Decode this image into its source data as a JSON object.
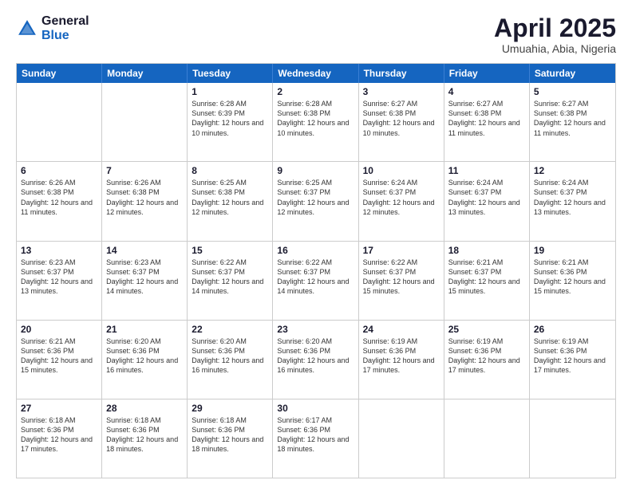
{
  "logo": {
    "general": "General",
    "blue": "Blue"
  },
  "title": {
    "month": "April 2025",
    "location": "Umuahia, Abia, Nigeria"
  },
  "weekdays": [
    "Sunday",
    "Monday",
    "Tuesday",
    "Wednesday",
    "Thursday",
    "Friday",
    "Saturday"
  ],
  "rows": [
    [
      {
        "day": "",
        "info": ""
      },
      {
        "day": "",
        "info": ""
      },
      {
        "day": "1",
        "info": "Sunrise: 6:28 AM\nSunset: 6:39 PM\nDaylight: 12 hours and 10 minutes."
      },
      {
        "day": "2",
        "info": "Sunrise: 6:28 AM\nSunset: 6:38 PM\nDaylight: 12 hours and 10 minutes."
      },
      {
        "day": "3",
        "info": "Sunrise: 6:27 AM\nSunset: 6:38 PM\nDaylight: 12 hours and 10 minutes."
      },
      {
        "day": "4",
        "info": "Sunrise: 6:27 AM\nSunset: 6:38 PM\nDaylight: 12 hours and 11 minutes."
      },
      {
        "day": "5",
        "info": "Sunrise: 6:27 AM\nSunset: 6:38 PM\nDaylight: 12 hours and 11 minutes."
      }
    ],
    [
      {
        "day": "6",
        "info": "Sunrise: 6:26 AM\nSunset: 6:38 PM\nDaylight: 12 hours and 11 minutes."
      },
      {
        "day": "7",
        "info": "Sunrise: 6:26 AM\nSunset: 6:38 PM\nDaylight: 12 hours and 12 minutes."
      },
      {
        "day": "8",
        "info": "Sunrise: 6:25 AM\nSunset: 6:38 PM\nDaylight: 12 hours and 12 minutes."
      },
      {
        "day": "9",
        "info": "Sunrise: 6:25 AM\nSunset: 6:37 PM\nDaylight: 12 hours and 12 minutes."
      },
      {
        "day": "10",
        "info": "Sunrise: 6:24 AM\nSunset: 6:37 PM\nDaylight: 12 hours and 12 minutes."
      },
      {
        "day": "11",
        "info": "Sunrise: 6:24 AM\nSunset: 6:37 PM\nDaylight: 12 hours and 13 minutes."
      },
      {
        "day": "12",
        "info": "Sunrise: 6:24 AM\nSunset: 6:37 PM\nDaylight: 12 hours and 13 minutes."
      }
    ],
    [
      {
        "day": "13",
        "info": "Sunrise: 6:23 AM\nSunset: 6:37 PM\nDaylight: 12 hours and 13 minutes."
      },
      {
        "day": "14",
        "info": "Sunrise: 6:23 AM\nSunset: 6:37 PM\nDaylight: 12 hours and 14 minutes."
      },
      {
        "day": "15",
        "info": "Sunrise: 6:22 AM\nSunset: 6:37 PM\nDaylight: 12 hours and 14 minutes."
      },
      {
        "day": "16",
        "info": "Sunrise: 6:22 AM\nSunset: 6:37 PM\nDaylight: 12 hours and 14 minutes."
      },
      {
        "day": "17",
        "info": "Sunrise: 6:22 AM\nSunset: 6:37 PM\nDaylight: 12 hours and 15 minutes."
      },
      {
        "day": "18",
        "info": "Sunrise: 6:21 AM\nSunset: 6:37 PM\nDaylight: 12 hours and 15 minutes."
      },
      {
        "day": "19",
        "info": "Sunrise: 6:21 AM\nSunset: 6:36 PM\nDaylight: 12 hours and 15 minutes."
      }
    ],
    [
      {
        "day": "20",
        "info": "Sunrise: 6:21 AM\nSunset: 6:36 PM\nDaylight: 12 hours and 15 minutes."
      },
      {
        "day": "21",
        "info": "Sunrise: 6:20 AM\nSunset: 6:36 PM\nDaylight: 12 hours and 16 minutes."
      },
      {
        "day": "22",
        "info": "Sunrise: 6:20 AM\nSunset: 6:36 PM\nDaylight: 12 hours and 16 minutes."
      },
      {
        "day": "23",
        "info": "Sunrise: 6:20 AM\nSunset: 6:36 PM\nDaylight: 12 hours and 16 minutes."
      },
      {
        "day": "24",
        "info": "Sunrise: 6:19 AM\nSunset: 6:36 PM\nDaylight: 12 hours and 17 minutes."
      },
      {
        "day": "25",
        "info": "Sunrise: 6:19 AM\nSunset: 6:36 PM\nDaylight: 12 hours and 17 minutes."
      },
      {
        "day": "26",
        "info": "Sunrise: 6:19 AM\nSunset: 6:36 PM\nDaylight: 12 hours and 17 minutes."
      }
    ],
    [
      {
        "day": "27",
        "info": "Sunrise: 6:18 AM\nSunset: 6:36 PM\nDaylight: 12 hours and 17 minutes."
      },
      {
        "day": "28",
        "info": "Sunrise: 6:18 AM\nSunset: 6:36 PM\nDaylight: 12 hours and 18 minutes."
      },
      {
        "day": "29",
        "info": "Sunrise: 6:18 AM\nSunset: 6:36 PM\nDaylight: 12 hours and 18 minutes."
      },
      {
        "day": "30",
        "info": "Sunrise: 6:17 AM\nSunset: 6:36 PM\nDaylight: 12 hours and 18 minutes."
      },
      {
        "day": "",
        "info": ""
      },
      {
        "day": "",
        "info": ""
      },
      {
        "day": "",
        "info": ""
      }
    ]
  ]
}
